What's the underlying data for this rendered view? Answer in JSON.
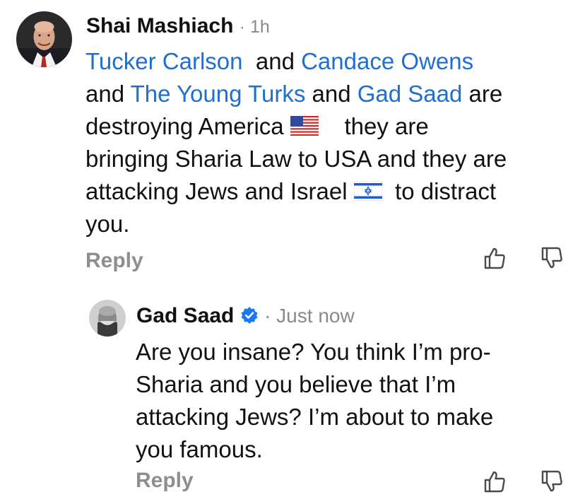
{
  "comment": {
    "author": "Shai Mashiach",
    "time": "· 1h",
    "lines": {
      "l1_m1": "Tucker Carlson",
      "l1_t1": "and",
      "l1_m2": "Candace Owens",
      "l2_t1": "and",
      "l2_m1": "The Young Turks",
      "l2_t2": "and",
      "l2_m2": "Gad Saad",
      "l2_t3": "are",
      "l3_t1": "destroying America",
      "l3_t2": "they are",
      "l4": "bringing Sharia Law to USA and they are",
      "l5_t1": "attacking Jews and Israel",
      "l5_t2": "to distract",
      "l6": "you."
    },
    "reply_label": "Reply",
    "like_icon": "thumbs-up-icon",
    "dislike_icon": "thumbs-down-icon"
  },
  "reply": {
    "author": "Gad Saad",
    "time": "· Just now",
    "verified_icon": "verified-badge-icon",
    "lines": [
      "Are you insane? You think I’m pro-",
      "Sharia and you believe that I’m",
      "attacking Jews? I’m about to make",
      "you famous."
    ],
    "reply_label": "Reply"
  },
  "colors": {
    "mention": "#1f6fd1",
    "meta": "#8a8a8a",
    "verified": "#1877f2"
  }
}
